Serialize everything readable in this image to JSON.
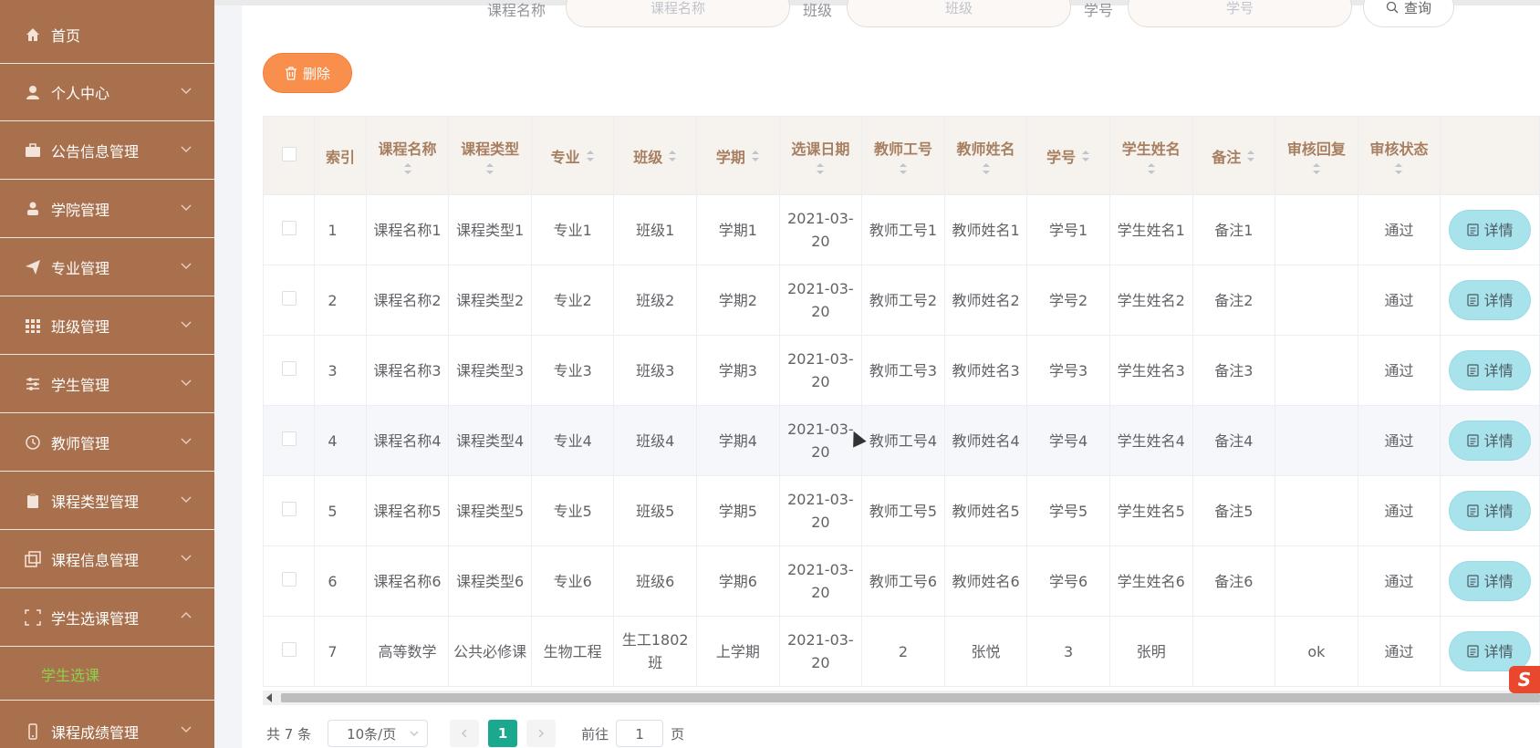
{
  "sidebar": {
    "items": [
      {
        "label": "首页",
        "icon": "home-icon",
        "has_chevron": false
      },
      {
        "label": "个人中心",
        "icon": "user-icon",
        "has_chevron": true
      },
      {
        "label": "公告信息管理",
        "icon": "briefcase-icon",
        "has_chevron": true
      },
      {
        "label": "学院管理",
        "icon": "person-icon",
        "has_chevron": true
      },
      {
        "label": "专业管理",
        "icon": "send-icon",
        "has_chevron": true
      },
      {
        "label": "班级管理",
        "icon": "grid-icon",
        "has_chevron": true
      },
      {
        "label": "学生管理",
        "icon": "sliders-icon",
        "has_chevron": true
      },
      {
        "label": "教师管理",
        "icon": "clock-icon",
        "has_chevron": true
      },
      {
        "label": "课程类型管理",
        "icon": "clipboard-icon",
        "has_chevron": true
      },
      {
        "label": "课程信息管理",
        "icon": "copy-icon",
        "has_chevron": true
      },
      {
        "label": "学生选课管理",
        "icon": "frame-icon",
        "has_chevron": true,
        "expanded": true
      },
      {
        "label": "课程成绩管理",
        "icon": "phone-icon",
        "has_chevron": true
      }
    ],
    "sub_item": "学生选课"
  },
  "search": {
    "fields": [
      {
        "label": "课程名称",
        "placeholder": "课程名称"
      },
      {
        "label": "班级",
        "placeholder": "班级"
      },
      {
        "label": "学号",
        "placeholder": "学号"
      }
    ],
    "button": "查询"
  },
  "toolbar": {
    "delete_label": "删除"
  },
  "table": {
    "headers": [
      "索引",
      "课程名称",
      "课程类型",
      "专业",
      "班级",
      "学期",
      "选课日期",
      "教师工号",
      "教师姓名",
      "学号",
      "学生姓名",
      "备注",
      "审核回复",
      "审核状态"
    ],
    "rows": [
      {
        "index": "1",
        "course": "课程名称1",
        "type": "课程类型1",
        "major": "专业1",
        "cls": "班级1",
        "term": "学期1",
        "date": "2021-03-20",
        "tid": "教师工号1",
        "tname": "教师姓名1",
        "sid": "学号1",
        "sname": "学生姓名1",
        "note": "备注1",
        "reply": "",
        "status": "通过"
      },
      {
        "index": "2",
        "course": "课程名称2",
        "type": "课程类型2",
        "major": "专业2",
        "cls": "班级2",
        "term": "学期2",
        "date": "2021-03-20",
        "tid": "教师工号2",
        "tname": "教师姓名2",
        "sid": "学号2",
        "sname": "学生姓名2",
        "note": "备注2",
        "reply": "",
        "status": "通过"
      },
      {
        "index": "3",
        "course": "课程名称3",
        "type": "课程类型3",
        "major": "专业3",
        "cls": "班级3",
        "term": "学期3",
        "date": "2021-03-20",
        "tid": "教师工号3",
        "tname": "教师姓名3",
        "sid": "学号3",
        "sname": "学生姓名3",
        "note": "备注3",
        "reply": "",
        "status": "通过"
      },
      {
        "index": "4",
        "course": "课程名称4",
        "type": "课程类型4",
        "major": "专业4",
        "cls": "班级4",
        "term": "学期4",
        "date": "2021-03-20",
        "tid": "教师工号4",
        "tname": "教师姓名4",
        "sid": "学号4",
        "sname": "学生姓名4",
        "note": "备注4",
        "reply": "",
        "status": "通过"
      },
      {
        "index": "5",
        "course": "课程名称5",
        "type": "课程类型5",
        "major": "专业5",
        "cls": "班级5",
        "term": "学期5",
        "date": "2021-03-20",
        "tid": "教师工号5",
        "tname": "教师姓名5",
        "sid": "学号5",
        "sname": "学生姓名5",
        "note": "备注5",
        "reply": "",
        "status": "通过"
      },
      {
        "index": "6",
        "course": "课程名称6",
        "type": "课程类型6",
        "major": "专业6",
        "cls": "班级6",
        "term": "学期6",
        "date": "2021-03-20",
        "tid": "教师工号6",
        "tname": "教师姓名6",
        "sid": "学号6",
        "sname": "学生姓名6",
        "note": "备注6",
        "reply": "",
        "status": "通过"
      },
      {
        "index": "7",
        "course": "高等数学",
        "type": "公共必修课",
        "major": "生物工程",
        "cls": "生工1802班",
        "term": "上学期",
        "date": "2021-03-20",
        "tid": "2",
        "tname": "张悦",
        "sid": "3",
        "sname": "张明",
        "note": "",
        "reply": "ok",
        "status": "通过"
      }
    ],
    "detail_label": "详情"
  },
  "pagination": {
    "total": "共 7 条",
    "page_size": "10条/页",
    "current_page": "1",
    "goto_label": "前往",
    "goto_value": "1",
    "page_suffix": "页"
  },
  "colors": {
    "sidebar_bg": "#a9704e",
    "accent_orange": "#f98f4d",
    "detail_btn": "#a8e3ec",
    "pager_active": "#1aa88e",
    "sub_item_text": "#8bd14b"
  }
}
